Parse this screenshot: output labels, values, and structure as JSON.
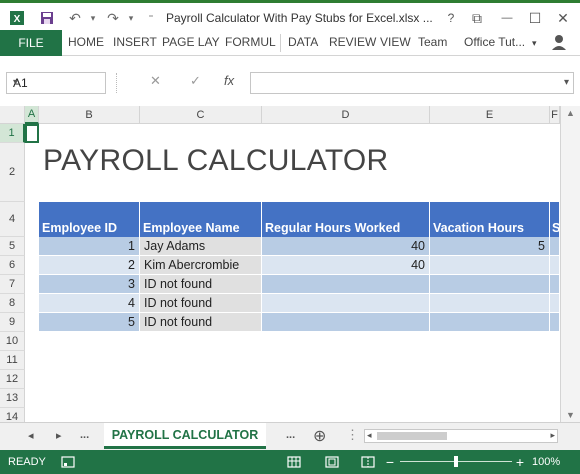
{
  "window": {
    "title": "Payroll Calculator With Pay Stubs for Excel.xlsx ...",
    "help": "?",
    "ribbon_toggle": "⧉",
    "minimize": "—",
    "restore": "☐",
    "close": "✕"
  },
  "ribbon": {
    "file": "FILE",
    "tabs": [
      "HOME",
      "INSERT",
      "PAGE LAY",
      "FORMUL",
      "DATA",
      "REVIEW",
      "VIEW",
      "Team"
    ],
    "account": "Office Tut...",
    "account_caret": "▾"
  },
  "formula_bar": {
    "name_box": "A1",
    "cancel": "✕",
    "enter": "✓",
    "fx": "fx",
    "value": ""
  },
  "grid": {
    "columns": [
      "A",
      "B",
      "C",
      "D",
      "E",
      "F"
    ],
    "rows": [
      "1",
      "2",
      "4",
      "5",
      "6",
      "7",
      "8",
      "9",
      "10",
      "11",
      "12",
      "13",
      "14"
    ],
    "active_cell": "A1"
  },
  "sheet": {
    "title": "PAYROLL CALCULATOR",
    "headers": [
      "Employee ID",
      "Employee Name",
      "Regular Hours Worked",
      "Vacation Hours",
      "S"
    ],
    "rows": [
      {
        "id": "1",
        "name": "Jay Adams",
        "regular": "40",
        "vacation": "5"
      },
      {
        "id": "2",
        "name": "Kim Abercrombie",
        "regular": "40",
        "vacation": ""
      },
      {
        "id": "3",
        "name": "ID not found",
        "regular": "",
        "vacation": ""
      },
      {
        "id": "4",
        "name": "ID not found",
        "regular": "",
        "vacation": ""
      },
      {
        "id": "5",
        "name": "ID not found",
        "regular": "",
        "vacation": ""
      }
    ]
  },
  "sheet_tabs": {
    "prev": "◂",
    "next": "▸",
    "ellipsis_left": "...",
    "active": "PAYROLL CALCULATOR",
    "ellipsis_right": "...",
    "add": "⊕"
  },
  "status": {
    "text": "READY",
    "zoom": "100%",
    "zoom_fraction": 0.5
  },
  "colors": {
    "accent": "#217346",
    "header_blue": "#4472c4",
    "band_light": "#dbe5f1",
    "band_mid": "#b8cce4",
    "band_gray": "#e0e0e0"
  }
}
